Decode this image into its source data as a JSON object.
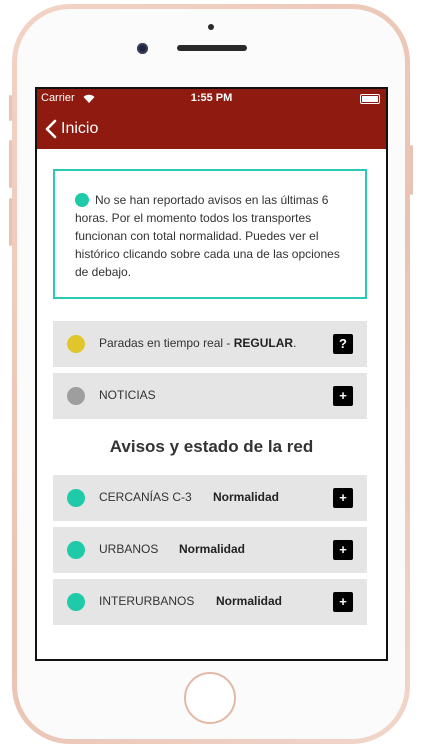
{
  "statusbar": {
    "carrier": "Carrier",
    "time": "1:55 PM"
  },
  "navbar": {
    "back_label": "Inicio"
  },
  "colors": {
    "nav_red": "#8f1a0f",
    "teal": "#1fcaa9",
    "yellow": "#e0c62a",
    "grey": "#9e9e9e",
    "row_bg": "#e6e5e5"
  },
  "notice": {
    "text": "No se han reportado avisos en las últimas 6 horas. Por el momento todos los transportes funcionan con total normalidad. Puedes ver el histórico clicando sobre cada una de las opciones de debajo.",
    "status_color": "teal"
  },
  "rows_top": [
    {
      "label": "Paradas en tiempo real - ",
      "label_bold": "REGULAR",
      "suffix": ".",
      "action": "?",
      "dot": "yellow"
    },
    {
      "label": "NOTICIAS",
      "action": "+",
      "dot": "grey"
    }
  ],
  "section_title": "Avisos y estado de la red",
  "network_rows": [
    {
      "label": "CERCANÍAS C-3",
      "status": "Normalidad",
      "action": "+",
      "dot": "teal"
    },
    {
      "label": "URBANOS",
      "status": "Normalidad",
      "action": "+",
      "dot": "teal"
    },
    {
      "label": "INTERURBANOS",
      "status": "Normalidad",
      "action": "+",
      "dot": "teal"
    }
  ]
}
